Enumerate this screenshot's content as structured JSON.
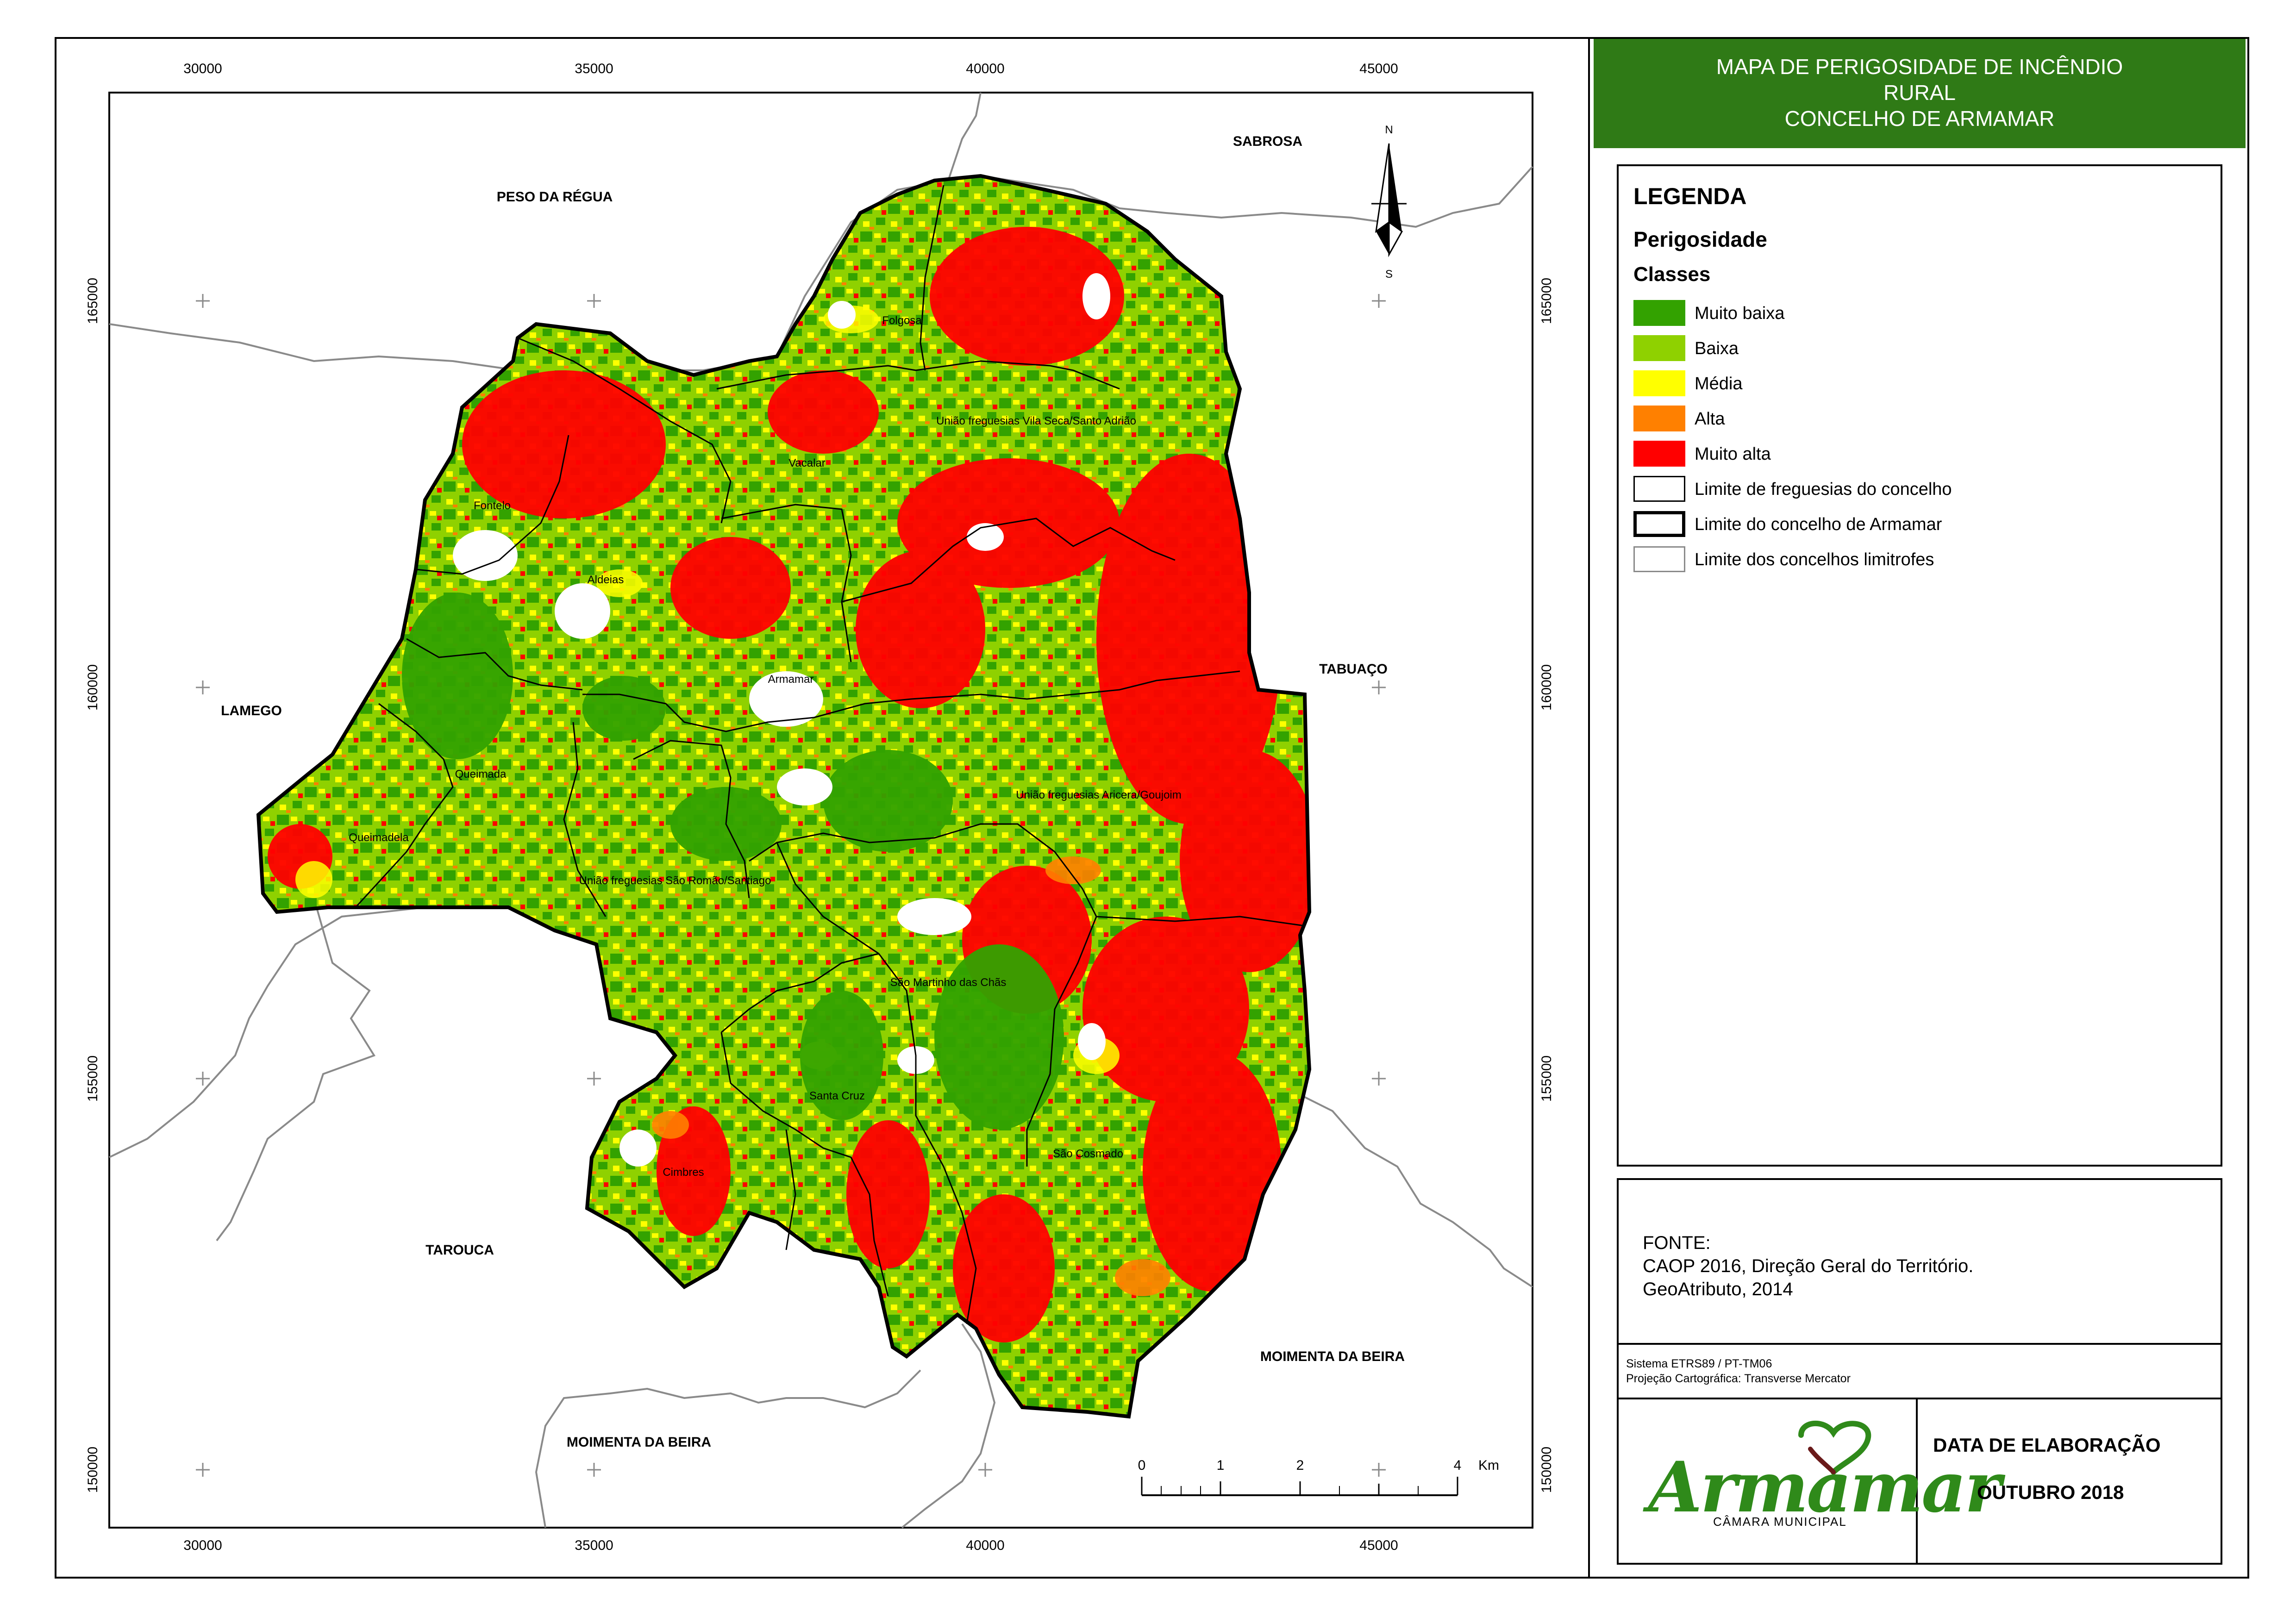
{
  "title": {
    "line1": "MAPA DE PERIGOSIDADE DE INCÊNDIO",
    "line2": "RURAL",
    "line3": "CONCELHO DE ARMAMAR"
  },
  "legend": {
    "heading": "LEGENDA",
    "subheading": "Perigosidade",
    "classes_heading": "Classes",
    "items": [
      {
        "label": "Muito baixa",
        "color": "#33a200"
      },
      {
        "label": "Baixa",
        "color": "#8fd100"
      },
      {
        "label": "Média",
        "color": "#ffff00"
      },
      {
        "label": "Alta",
        "color": "#ff8000"
      },
      {
        "label": "Muito alta",
        "color": "#ff0000"
      },
      {
        "label": "Limite de freguesias do concelho",
        "color": "#000000"
      },
      {
        "label": "Limite do concelho de Armamar",
        "color": "#000000"
      },
      {
        "label": "Limite dos concelhos limitrofes",
        "color": "#8a8a8a"
      }
    ]
  },
  "source": {
    "heading": "FONTE:",
    "line1": "CAOP 2016, Direção Geral do Território.",
    "line2": "GeoAtributo, 2014"
  },
  "projection": {
    "system": "Sistema ETRS89 / PT-TM06",
    "projection": "Projeção Cartográfica: Transverse Mercator"
  },
  "logo": {
    "word": "Armamar",
    "subtitle": "CÂMARA MUNICIPAL"
  },
  "date": {
    "heading": "DATA DE ELABORAÇÃO",
    "value": "OUTUBRO 2018"
  },
  "map": {
    "x_ticks": [
      "30000",
      "35000",
      "40000",
      "45000"
    ],
    "y_ticks": [
      "165000",
      "160000",
      "155000",
      "150000"
    ],
    "north": "N",
    "south": "S",
    "scale": {
      "labels": [
        "0",
        "1",
        "2",
        "4"
      ],
      "unit": "Km"
    },
    "neighbours": [
      "PESO DA RÉGUA",
      "SABROSA",
      "LAMEGO",
      "TABUAÇO",
      "TAROUCA",
      "MOIMENTA DA BEIRA",
      "MOIMENTA DA BEIRA"
    ],
    "parishes": [
      "Folgosa",
      "União freguesias Vila Seca/Santo Adrião",
      "Vacalar",
      "Fontelo",
      "Aldeias",
      "Armamar",
      "Queimada",
      "Queimadela",
      "União freguesias Aricera/Goujoim",
      "União freguesias São Romão/Santiago",
      "São Martinho das Chãs",
      "Santa Cruz",
      "Cimbres",
      "São Cosmado"
    ],
    "colors": {
      "very_low": "#33a200",
      "low": "#8fd100",
      "medium": "#ffff00",
      "high": "#ff8000",
      "very_high": "#ff0000"
    }
  }
}
